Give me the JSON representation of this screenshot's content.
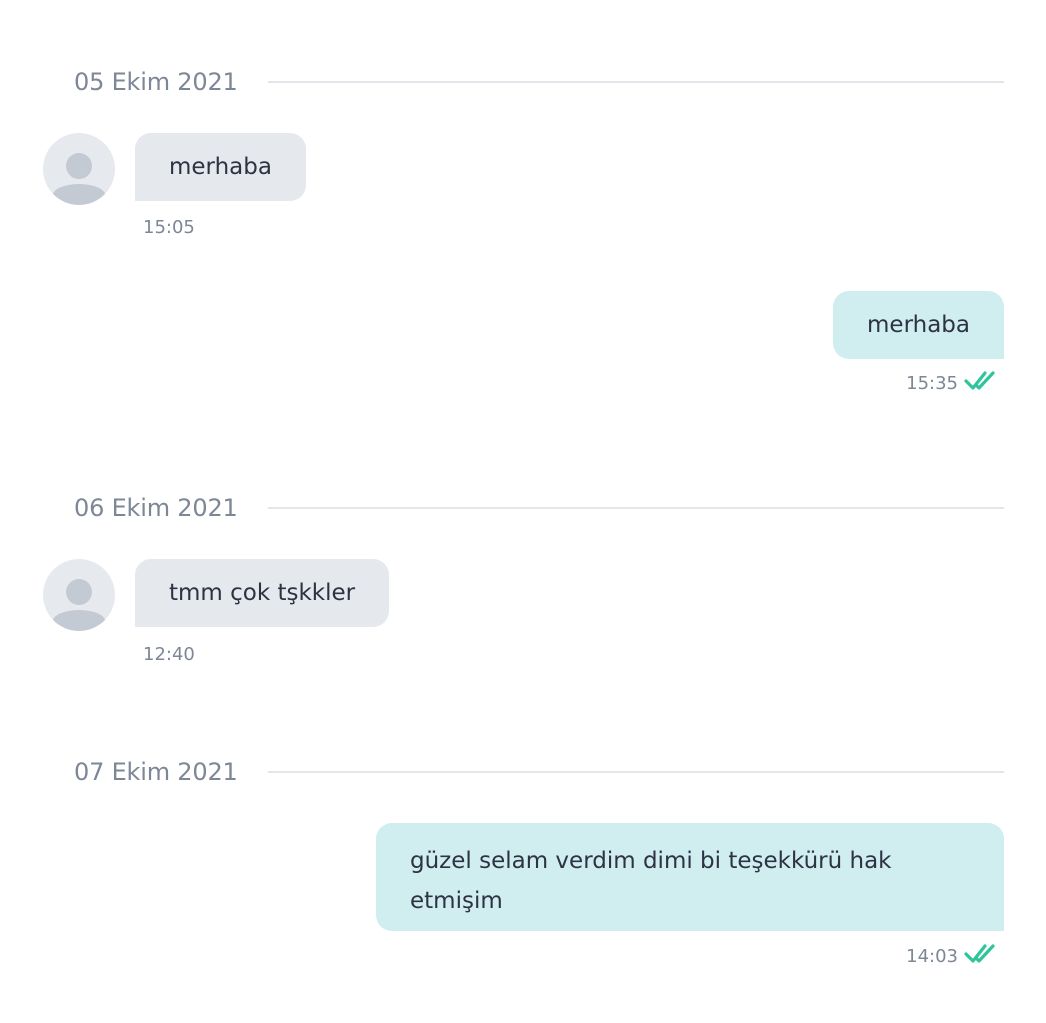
{
  "conversation": {
    "groups": [
      {
        "date": "05 Ekim 2021",
        "messages": [
          {
            "direction": "incoming",
            "text": "merhaba",
            "time": "15:05"
          },
          {
            "direction": "outgoing",
            "text": "merhaba",
            "time": "15:35",
            "status_icon": "double-check-icon"
          }
        ]
      },
      {
        "date": "06 Ekim 2021",
        "messages": [
          {
            "direction": "incoming",
            "text": "tmm çok tşkkler",
            "time": "12:40"
          }
        ]
      },
      {
        "date": "07 Ekim 2021",
        "messages": [
          {
            "direction": "outgoing",
            "text": "güzel selam verdim dimi bi teşekkürü hak etmişim",
            "time": "14:03",
            "status_icon": "double-check-icon"
          }
        ]
      }
    ]
  },
  "colors": {
    "incoming_bubble": "#e5e8ed",
    "outgoing_bubble": "#d0eef0",
    "read_check": "#2fc59a",
    "muted_text": "#7d8796",
    "avatar_bg": "#e6e9ee",
    "avatar_figure": "#c3cad4"
  }
}
